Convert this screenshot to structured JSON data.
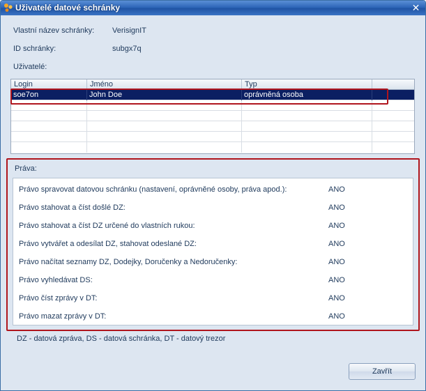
{
  "window": {
    "title": "Uživatelé datové schránky",
    "close_glyph": "✕",
    "title_icon": "dots-logo-icon",
    "accent_color": "#2a62b5",
    "highlight_color": "#b0151d"
  },
  "info": {
    "name_label": "Vlastní název schránky:",
    "name_value": "VerisignIT",
    "id_label": "ID schránky:",
    "id_value": "subgx7q",
    "users_label": "Uživatelé:"
  },
  "users_table": {
    "columns": [
      "Login",
      "Jméno",
      "Typ",
      ""
    ],
    "rows": [
      {
        "login": "soe7on",
        "name": "John Doe",
        "type": "oprávněná osoba",
        "selected": true
      }
    ]
  },
  "rights": {
    "title": "Práva:",
    "items": [
      {
        "label": "Právo spravovat datovou schránku (nastavení, oprávněné osoby, práva apod.):",
        "value": "ANO"
      },
      {
        "label": "Právo stahovat a číst došlé DZ:",
        "value": "ANO"
      },
      {
        "label": "Právo stahovat a číst DZ určené do vlastních rukou:",
        "value": "ANO"
      },
      {
        "label": "Právo vytvářet a odesílat DZ, stahovat odeslané DZ:",
        "value": "ANO"
      },
      {
        "label": "Právo načítat seznamy DZ, Dodejky, Doručenky a Nedoručenky:",
        "value": "ANO"
      },
      {
        "label": "Právo vyhledávat DS:",
        "value": "ANO"
      },
      {
        "label": "Právo číst zprávy v DT:",
        "value": "ANO"
      },
      {
        "label": "Právo mazat zprávy v DT:",
        "value": "ANO"
      }
    ]
  },
  "legend": "DZ - datová zpráva, DS - datová schránka, DT - datový trezor",
  "buttons": {
    "close_label": "Zavřít"
  }
}
